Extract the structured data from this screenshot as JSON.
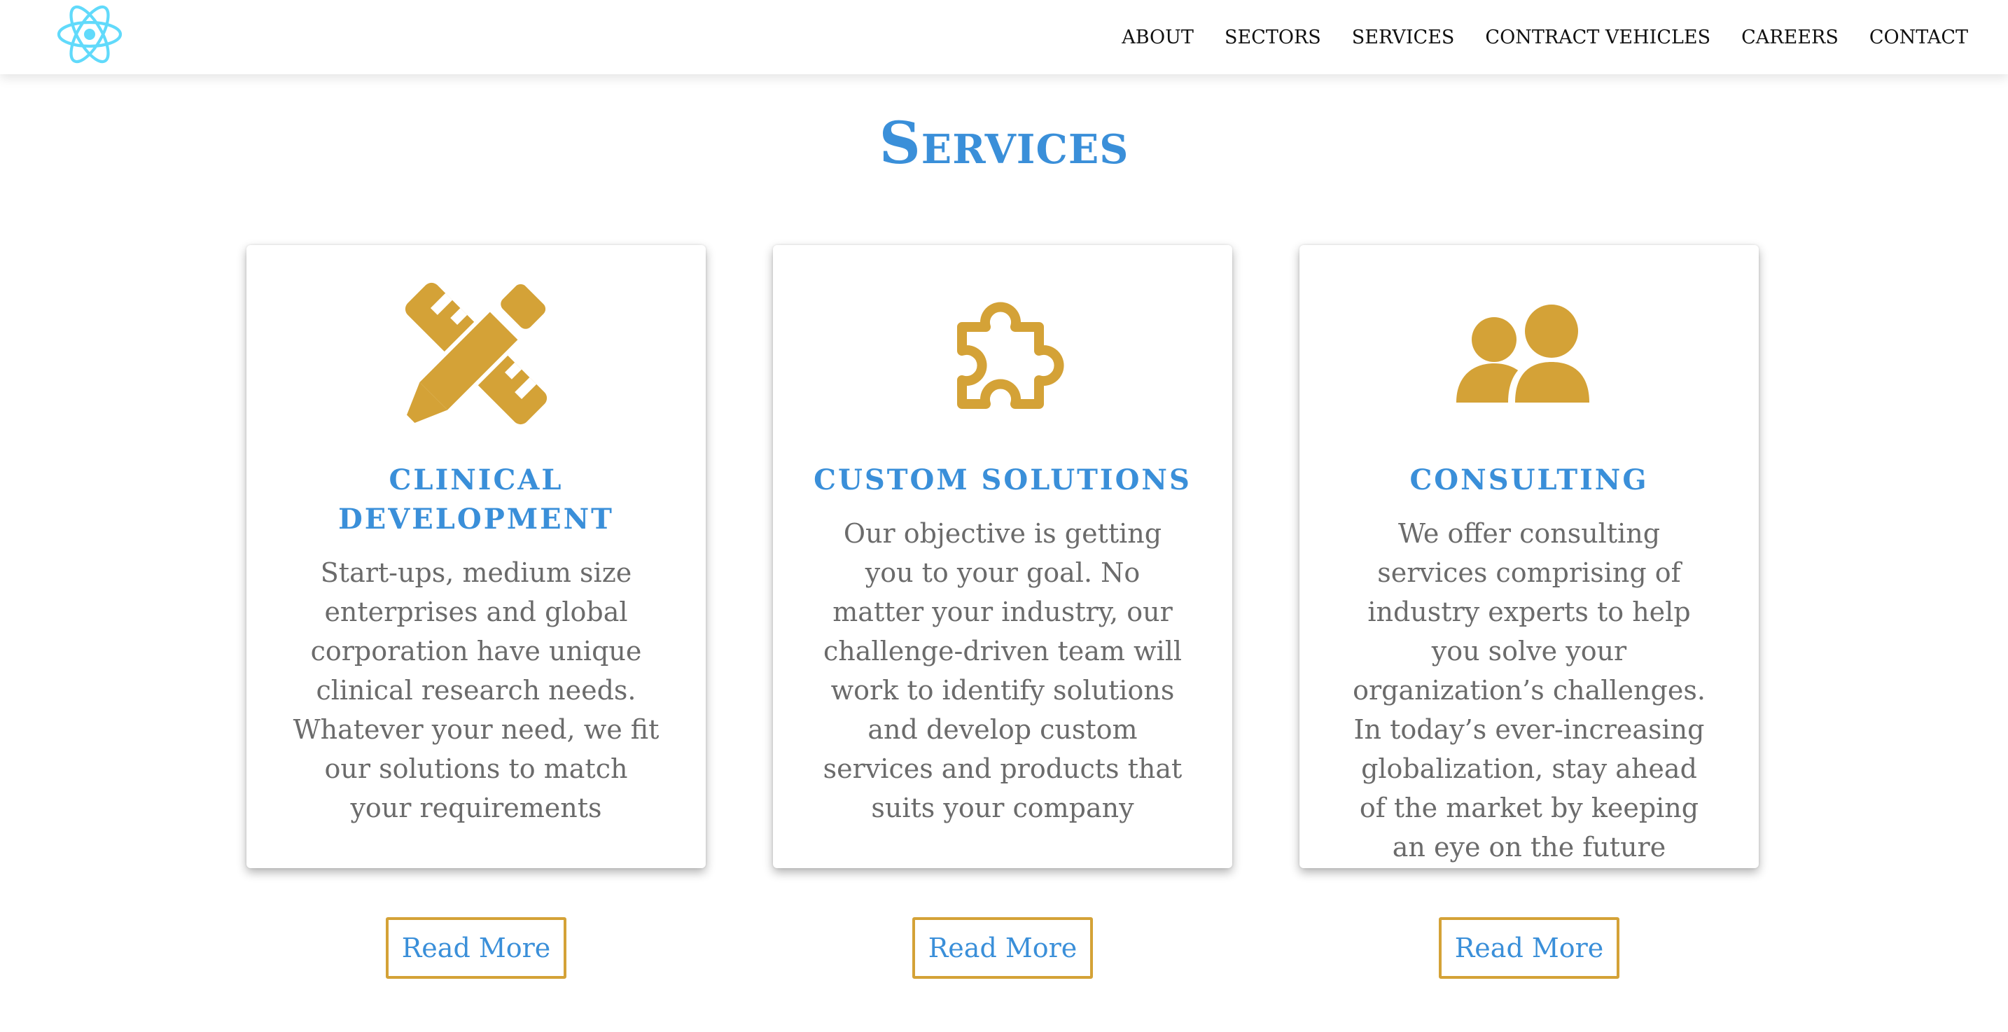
{
  "header": {
    "logo": "react-atom-logo",
    "nav": {
      "about": "ABOUT",
      "sectors": "SECTORS",
      "services": "SERVICES",
      "contract_vehicles": "CONTRACT VEHICLES",
      "careers": "CAREERS",
      "contact": "CONTACT"
    }
  },
  "main": {
    "title": "Services",
    "cards": [
      {
        "icon": "pencil-ruler-icon",
        "title": "Clinical Development",
        "text": "Start-ups, medium size enterprises and global corporation have unique clinical research needs. Whatever your need, we fit our solutions to match your requirements",
        "button": "Read More"
      },
      {
        "icon": "puzzle-piece-icon",
        "title": "Custom Solutions",
        "text": "Our objective is getting you to your goal. No matter your industry, our challenge-driven team will work to identify solutions and develop custom services and products that suits your company",
        "button": "Read More"
      },
      {
        "icon": "users-icon",
        "title": "Consulting",
        "text": "We offer consulting services comprising of industry experts to help you solve your organization’s challenges. In today’s ever-increasing globalization, stay ahead of the market by keeping an eye on the future",
        "button": "Read More"
      }
    ]
  },
  "colors": {
    "accent_blue": "#3a8fd9",
    "gold": "#d4a237",
    "body_text": "#6b6b6b",
    "logo_cyan": "#61dafb"
  }
}
